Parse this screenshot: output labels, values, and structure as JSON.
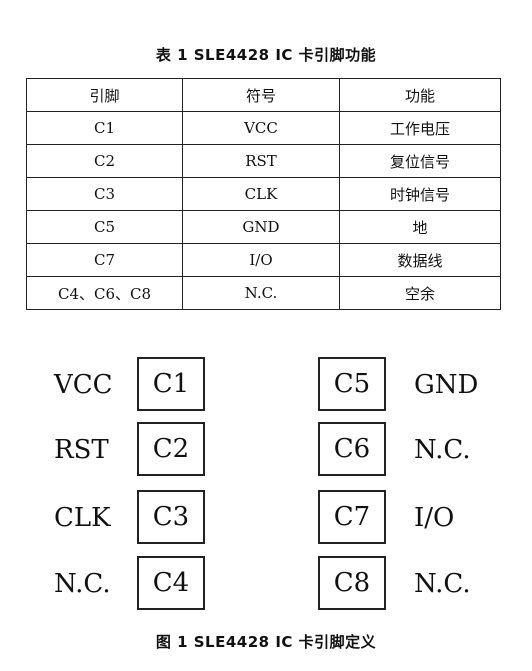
{
  "table_title": "表 1  SLE4428 IC 卡引脚功能",
  "table": {
    "headers": [
      "引脚",
      "符号",
      "功能"
    ],
    "rows": [
      [
        "C1",
        "VCC",
        "工作电压"
      ],
      [
        "C2",
        "RST",
        "复位信号"
      ],
      [
        "C3",
        "CLK",
        "时钟信号"
      ],
      [
        "C5",
        "GND",
        "地"
      ],
      [
        "C7",
        "I/O",
        "数据线"
      ],
      [
        "C4、C6、C8",
        "N.C.",
        "空余"
      ]
    ]
  },
  "diagram": {
    "left_pins": [
      {
        "signal": "VCC",
        "pin": "C1"
      },
      {
        "signal": "RST",
        "pin": "C2"
      },
      {
        "signal": "CLK",
        "pin": "C3"
      },
      {
        "signal": "N.C.",
        "pin": "C4"
      }
    ],
    "right_pins": [
      {
        "pin": "C5",
        "signal": "GND"
      },
      {
        "pin": "C6",
        "signal": "N.C."
      },
      {
        "pin": "C7",
        "signal": "I/O"
      },
      {
        "pin": "C8",
        "signal": "N.C."
      }
    ]
  },
  "figure_caption": "图 1  SLE4428 IC 卡引脚定义"
}
